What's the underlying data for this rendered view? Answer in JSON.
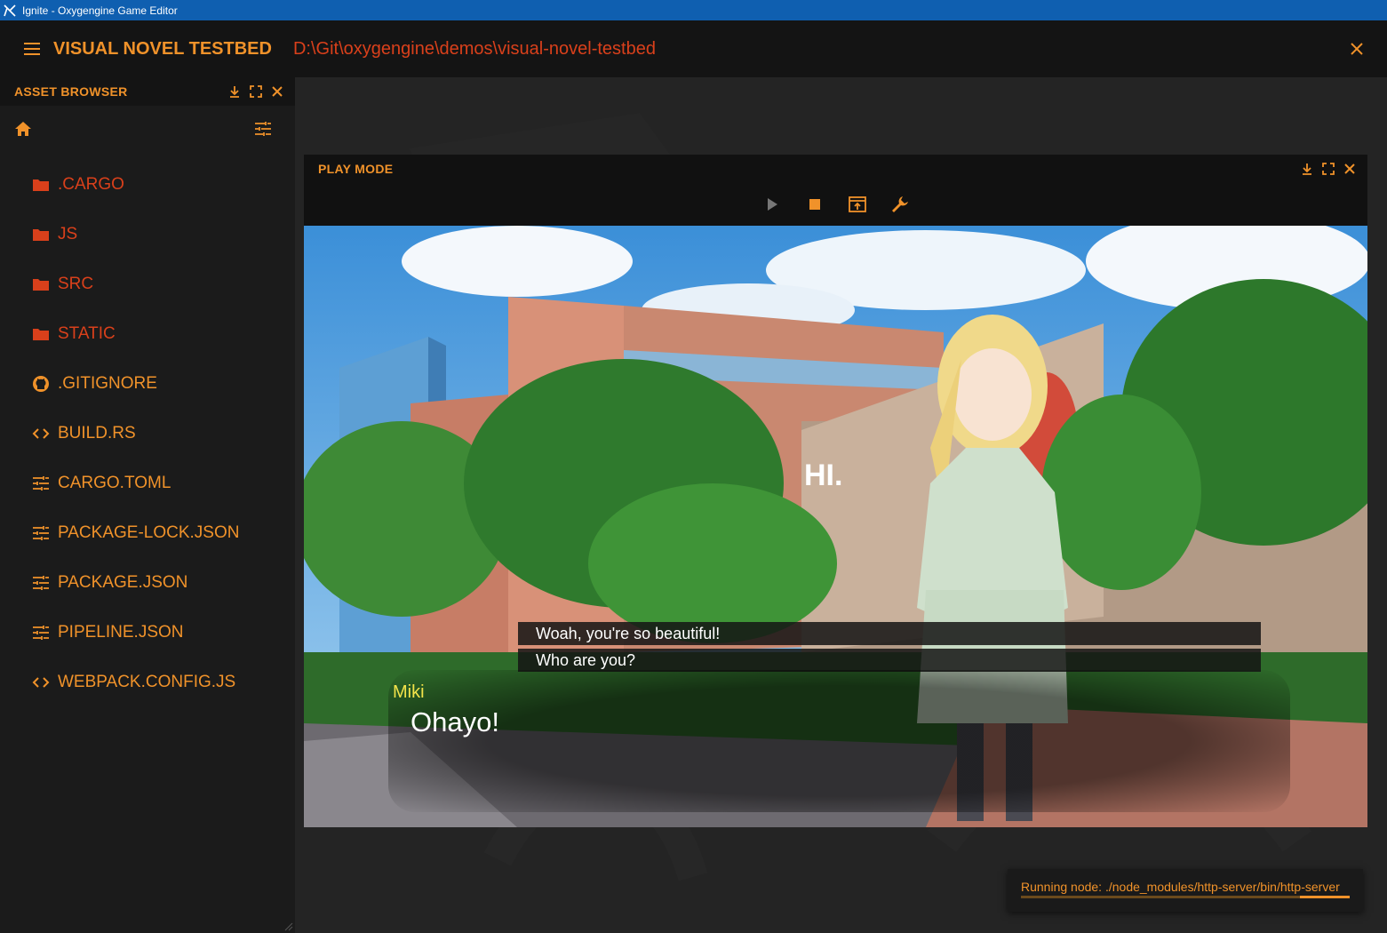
{
  "window": {
    "title": "Ignite - Oxygengine Game Editor"
  },
  "appbar": {
    "project_name": "VISUAL NOVEL TESTBED",
    "project_path": "D:\\Git\\oxygengine\\demos\\visual-novel-testbed"
  },
  "asset_browser": {
    "title": "ASSET BROWSER",
    "items": [
      {
        "label": ".CARGO",
        "icon": "folder-icon",
        "kind": "dir"
      },
      {
        "label": "JS",
        "icon": "folder-icon",
        "kind": "dir"
      },
      {
        "label": "SRC",
        "icon": "folder-icon",
        "kind": "dir"
      },
      {
        "label": "STATIC",
        "icon": "folder-icon",
        "kind": "dir"
      },
      {
        "label": ".GITIGNORE",
        "icon": "github-icon",
        "kind": "file"
      },
      {
        "label": "BUILD.RS",
        "icon": "code-icon",
        "kind": "file"
      },
      {
        "label": "CARGO.TOML",
        "icon": "tune-icon",
        "kind": "file"
      },
      {
        "label": "PACKAGE-LOCK.JSON",
        "icon": "tune-icon",
        "kind": "file"
      },
      {
        "label": "PACKAGE.JSON",
        "icon": "tune-icon",
        "kind": "file"
      },
      {
        "label": "PIPELINE.JSON",
        "icon": "tune-icon",
        "kind": "file"
      },
      {
        "label": "WEBPACK.CONFIG.JS",
        "icon": "code-icon",
        "kind": "file"
      }
    ]
  },
  "play_mode": {
    "title": "PLAY MODE",
    "scene": {
      "sign_text": "HI.",
      "choices": [
        "Woah, you're so beautiful!",
        "Who are you?"
      ],
      "speaker": "Miki",
      "line": "Ohayo!"
    }
  },
  "toast": {
    "message": "Running node: ./node_modules/http-server/bin/http-server",
    "progress_percent": 15
  },
  "colors": {
    "accent": "#f0922a",
    "dir": "#d9401b",
    "titlebar": "#0f5fb0",
    "speaker": "#f2e34a"
  }
}
